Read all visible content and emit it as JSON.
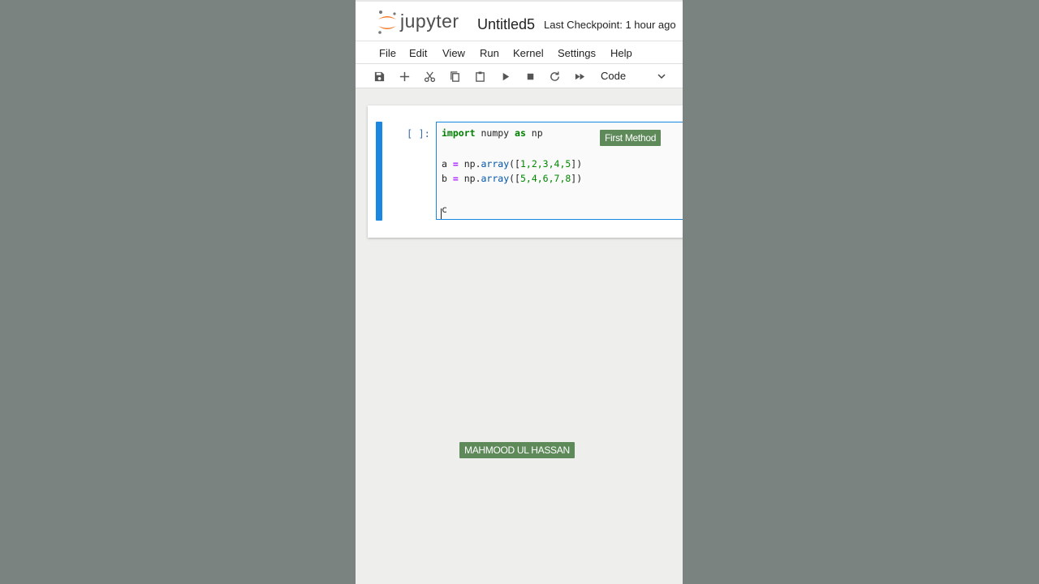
{
  "header": {
    "brand": "jupyter",
    "notebook_name": "Untitled5",
    "checkpoint": "Last Checkpoint: 1 hour ago"
  },
  "menu": {
    "items": [
      "File",
      "Edit",
      "View",
      "Run",
      "Kernel",
      "Settings",
      "Help"
    ]
  },
  "toolbar": {
    "buttons": [
      "save-icon",
      "plus-icon",
      "scissors-icon",
      "copy-icon",
      "paste-icon",
      "play-icon",
      "stop-icon",
      "refresh-icon",
      "fast-forward-icon"
    ],
    "cell_type": "Code"
  },
  "cell": {
    "prompt": "[ ]:",
    "code": {
      "line1": {
        "kw1": "import",
        "mid": " numpy ",
        "kw2": "as",
        "end": " np"
      },
      "line2": {
        "var": "a ",
        "op": "=",
        "pre": " np.",
        "fn": "array",
        "args": "([",
        "nums": "1,2,3,4,5",
        "close": "])"
      },
      "line3": {
        "var": "b ",
        "op": "=",
        "pre": " np.",
        "fn": "array",
        "args": "([",
        "nums": "5,4,6,7,8",
        "close": "])"
      },
      "line4": "c"
    }
  },
  "overlays": {
    "method_label": "First Method",
    "author_label": "MAHMOOD UL HASSAN"
  },
  "colors": {
    "accent_blue": "#1a88e0",
    "badge_green": "#5e8a5a",
    "jupyter_orange": "#f37726"
  }
}
